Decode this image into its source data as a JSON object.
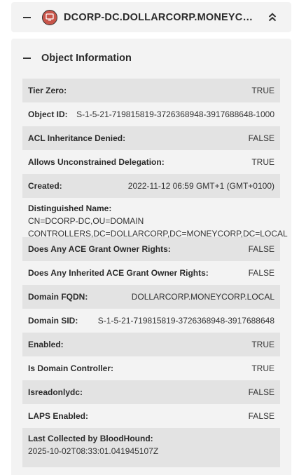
{
  "header": {
    "title": "DCORP-DC.DOLLARCORP.MONEYCORP.L...",
    "icon": "computer-icon",
    "icon_color": "#c8554a"
  },
  "section": {
    "title": "Object Information"
  },
  "properties": [
    {
      "key": "Tier Zero:",
      "value": "TRUE"
    },
    {
      "key": "Object ID:",
      "value": "S-1-5-21-719815819-3726368948-3917688648-1000"
    },
    {
      "key": "ACL Inheritance Denied:",
      "value": "FALSE"
    },
    {
      "key": "Allows Unconstrained Delegation:",
      "value": "TRUE"
    },
    {
      "key": "Created:",
      "value": "2022-11-12 06:59 GMT+1 (GMT+0100)"
    },
    {
      "key": "Distinguished Name:",
      "value": "CN=DCORP-DC,OU=DOMAIN CONTROLLERS,DC=DOLLARCORP,DC=MONEYCORP,DC=LOCAL"
    },
    {
      "key": "Does Any ACE Grant Owner Rights:",
      "value": "FALSE"
    },
    {
      "key": "Does Any Inherited ACE Grant Owner Rights:",
      "value": "FALSE"
    },
    {
      "key": "Domain FQDN:",
      "value": "DOLLARCORP.MONEYCORP.LOCAL"
    },
    {
      "key": "Domain SID:",
      "value": "S-1-5-21-719815819-3726368948-3917688648"
    },
    {
      "key": "Enabled:",
      "value": "TRUE"
    },
    {
      "key": "Is Domain Controller:",
      "value": "TRUE"
    },
    {
      "key": "Isreadonlydc:",
      "value": "FALSE"
    },
    {
      "key": "LAPS Enabled:",
      "value": "FALSE"
    },
    {
      "key": "Last Collected by BloodHound:",
      "value": "2025-10-02T08:33:01.041945107Z"
    }
  ]
}
